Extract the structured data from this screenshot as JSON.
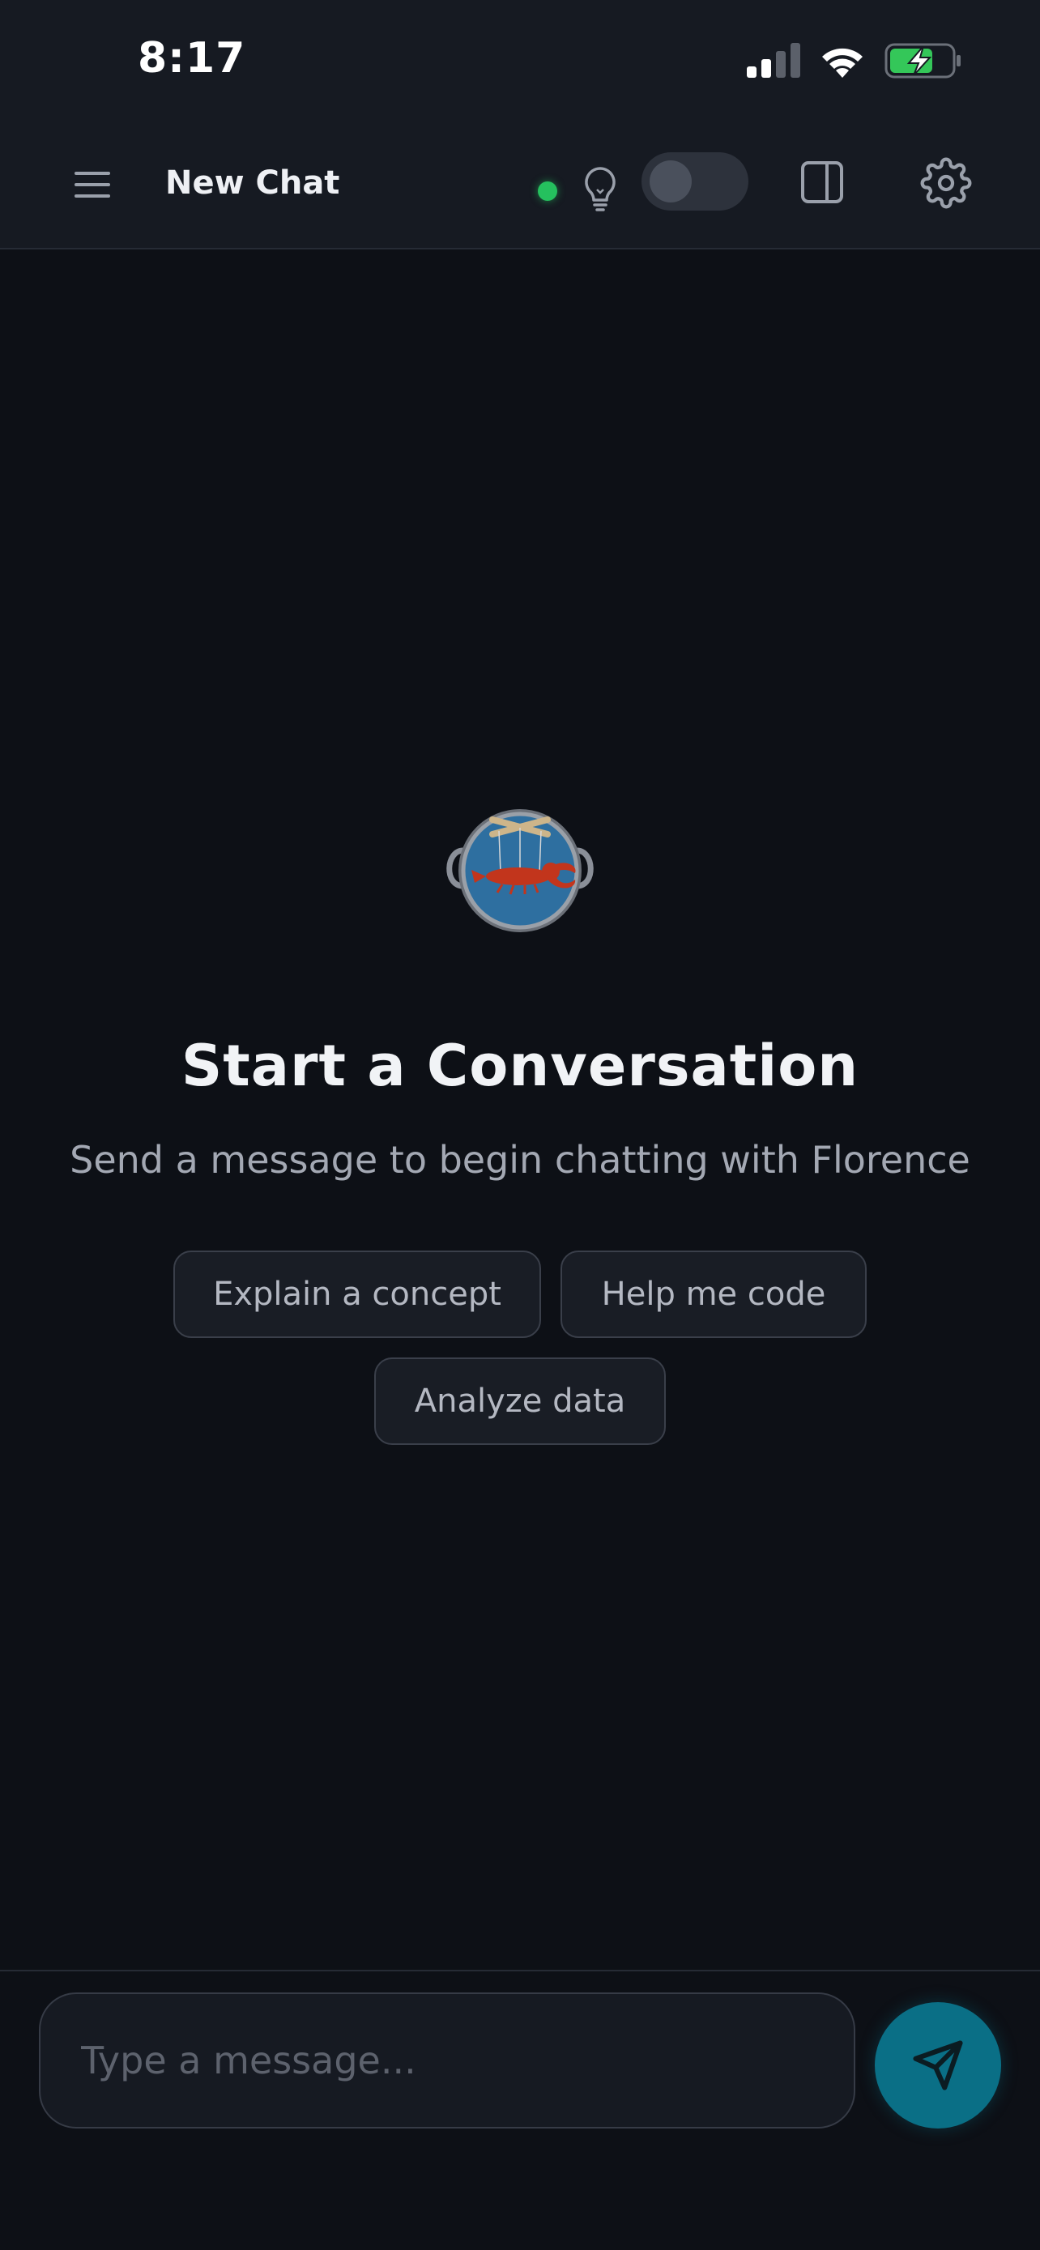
{
  "status_bar": {
    "time": "8:17",
    "icons": [
      "signal-icon",
      "wifi-icon",
      "battery-charging-icon"
    ]
  },
  "header": {
    "menu_icon": "hamburger-menu-icon",
    "title": "New Chat",
    "status_color": "#25c05e",
    "bulb_icon": "lightbulb-icon",
    "toggle_on": false,
    "panel_icon": "side-panel-icon",
    "settings_icon": "gear-icon"
  },
  "empty_state": {
    "logo": "lobster-pot-logo",
    "heading": "Start a Conversation",
    "subheading": "Send a message to begin chatting with Florence",
    "suggestions": [
      "Explain a concept",
      "Help me code",
      "Analyze data"
    ]
  },
  "composer": {
    "placeholder": "Type a message...",
    "send_icon": "send-icon",
    "send_color": "#0a6f86"
  }
}
